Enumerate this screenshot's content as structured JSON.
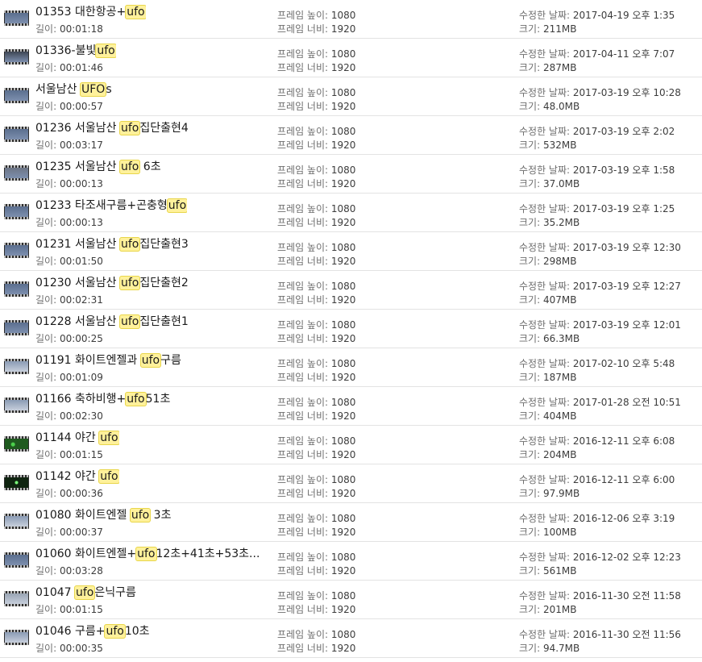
{
  "labels": {
    "length": "길이: ",
    "frame_height": "프레임 높이: ",
    "frame_width": "프레임 너비: ",
    "modified": "수정한 날짜: ",
    "size": "크기: "
  },
  "files": [
    {
      "name_parts": [
        "01353 대한항공+",
        "ufo",
        ""
      ],
      "length": "00:01:18",
      "frame_height": "1080",
      "frame_width": "1920",
      "modified": "2017-04-19 오후 1:35",
      "size": "211MB",
      "thumb": "plain"
    },
    {
      "name_parts": [
        "01336-불빛",
        "ufo",
        ""
      ],
      "length": "00:01:46",
      "frame_height": "1080",
      "frame_width": "1920",
      "modified": "2017-04-11 오후 7:07",
      "size": "287MB",
      "thumb": "dark"
    },
    {
      "name_parts": [
        "서울남산 ",
        "UFO",
        "s"
      ],
      "length": "00:00:57",
      "frame_height": "1080",
      "frame_width": "1920",
      "modified": "2017-03-19 오후 10:28",
      "size": "48.0MB",
      "thumb": "plain"
    },
    {
      "name_parts": [
        "01236 서울남산 ",
        "ufo",
        "집단출현4"
      ],
      "length": "00:03:17",
      "frame_height": "1080",
      "frame_width": "1920",
      "modified": "2017-03-19 오후 2:02",
      "size": "532MB",
      "thumb": "plain"
    },
    {
      "name_parts": [
        "01235 서울남산 ",
        "ufo",
        " 6초"
      ],
      "length": "00:00:13",
      "frame_height": "1080",
      "frame_width": "1920",
      "modified": "2017-03-19 오후 1:58",
      "size": "37.0MB",
      "thumb": "grey"
    },
    {
      "name_parts": [
        "01233 타조새구름+곤충형",
        "ufo",
        ""
      ],
      "length": "00:00:13",
      "frame_height": "1080",
      "frame_width": "1920",
      "modified": "2017-03-19 오후 1:25",
      "size": "35.2MB",
      "thumb": "plain"
    },
    {
      "name_parts": [
        "01231 서울남산 ",
        "ufo",
        "집단출현3"
      ],
      "length": "00:01:50",
      "frame_height": "1080",
      "frame_width": "1920",
      "modified": "2017-03-19 오후 12:30",
      "size": "298MB",
      "thumb": "plain"
    },
    {
      "name_parts": [
        "01230 서울남산 ",
        "ufo",
        "집단출현2"
      ],
      "length": "00:02:31",
      "frame_height": "1080",
      "frame_width": "1920",
      "modified": "2017-03-19 오후 12:27",
      "size": "407MB",
      "thumb": "plain"
    },
    {
      "name_parts": [
        "01228 서울남산 ",
        "ufo",
        "집단출현1"
      ],
      "length": "00:00:25",
      "frame_height": "1080",
      "frame_width": "1920",
      "modified": "2017-03-19 오후 12:01",
      "size": "66.3MB",
      "thumb": "plain"
    },
    {
      "name_parts": [
        "01191 화이트엔젤과 ",
        "ufo",
        "구름"
      ],
      "length": "00:01:09",
      "frame_height": "1080",
      "frame_width": "1920",
      "modified": "2017-02-10 오후 5:48",
      "size": "187MB",
      "thumb": "sky"
    },
    {
      "name_parts": [
        "01166 축하비행+",
        "ufo",
        "51초"
      ],
      "length": "00:02:30",
      "frame_height": "1080",
      "frame_width": "1920",
      "modified": "2017-01-28 오전 10:51",
      "size": "404MB",
      "thumb": "sky"
    },
    {
      "name_parts": [
        "01144 야간 ",
        "ufo",
        ""
      ],
      "length": "00:01:15",
      "frame_height": "1080",
      "frame_width": "1920",
      "modified": "2016-12-11 오후 6:08",
      "size": "204MB",
      "thumb": "green"
    },
    {
      "name_parts": [
        "01142 야간 ",
        "ufo",
        ""
      ],
      "length": "00:00:36",
      "frame_height": "1080",
      "frame_width": "1920",
      "modified": "2016-12-11 오후 6:00",
      "size": "97.9MB",
      "thumb": "night"
    },
    {
      "name_parts": [
        "01080 화이트엔젤 ",
        "ufo",
        " 3초"
      ],
      "length": "00:00:37",
      "frame_height": "1080",
      "frame_width": "1920",
      "modified": "2016-12-06 오후 3:19",
      "size": "100MB",
      "thumb": "sky"
    },
    {
      "name_parts": [
        "01060 화이트엔젤+",
        "ufo",
        "12초+41초+53초..."
      ],
      "length": "00:03:28",
      "frame_height": "1080",
      "frame_width": "1920",
      "modified": "2016-12-02 오후 12:23",
      "size": "561MB",
      "thumb": "plain"
    },
    {
      "name_parts": [
        "01047 ",
        "ufo",
        "은닉구름"
      ],
      "length": "00:01:15",
      "frame_height": "1080",
      "frame_width": "1920",
      "modified": "2016-11-30 오전 11:58",
      "size": "201MB",
      "thumb": "cloud"
    },
    {
      "name_parts": [
        "01046 구름+",
        "ufo",
        "10초"
      ],
      "length": "00:00:35",
      "frame_height": "1080",
      "frame_width": "1920",
      "modified": "2016-11-30 오전 11:56",
      "size": "94.7MB",
      "thumb": "sky"
    }
  ],
  "thumb_colors": {
    "plain": "#5b6f8f",
    "dark": "#3e4654",
    "grey": "#6c7585",
    "sky": "#8a9bb5",
    "green": "#1f5a1f",
    "night": "#0f2410",
    "cloud": "#9aa5b4"
  },
  "highlight_color": "#fff19b"
}
